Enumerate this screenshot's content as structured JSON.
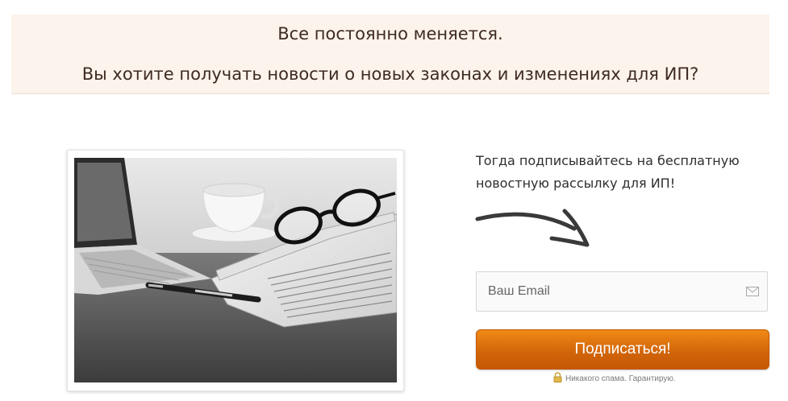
{
  "banner": {
    "line1": "Все постоянно меняется.",
    "line2": "Вы хотите получать новости о новых законах и изменениях для ИП?"
  },
  "image": {
    "icon": "newspaper-glasses-laptop-photo"
  },
  "intro": {
    "line1": "Тогда подписывайтесь на бесплатную",
    "line2": "новостную рассылку для ИП!"
  },
  "form": {
    "email_placeholder": "Ваш Email",
    "email_value": "",
    "email_icon": "envelope-icon",
    "submit_label": "Подписаться!",
    "accent_color": "#e07412"
  },
  "note": {
    "icon": "lock-icon",
    "text": "Никакого спама. Гарантирую."
  }
}
